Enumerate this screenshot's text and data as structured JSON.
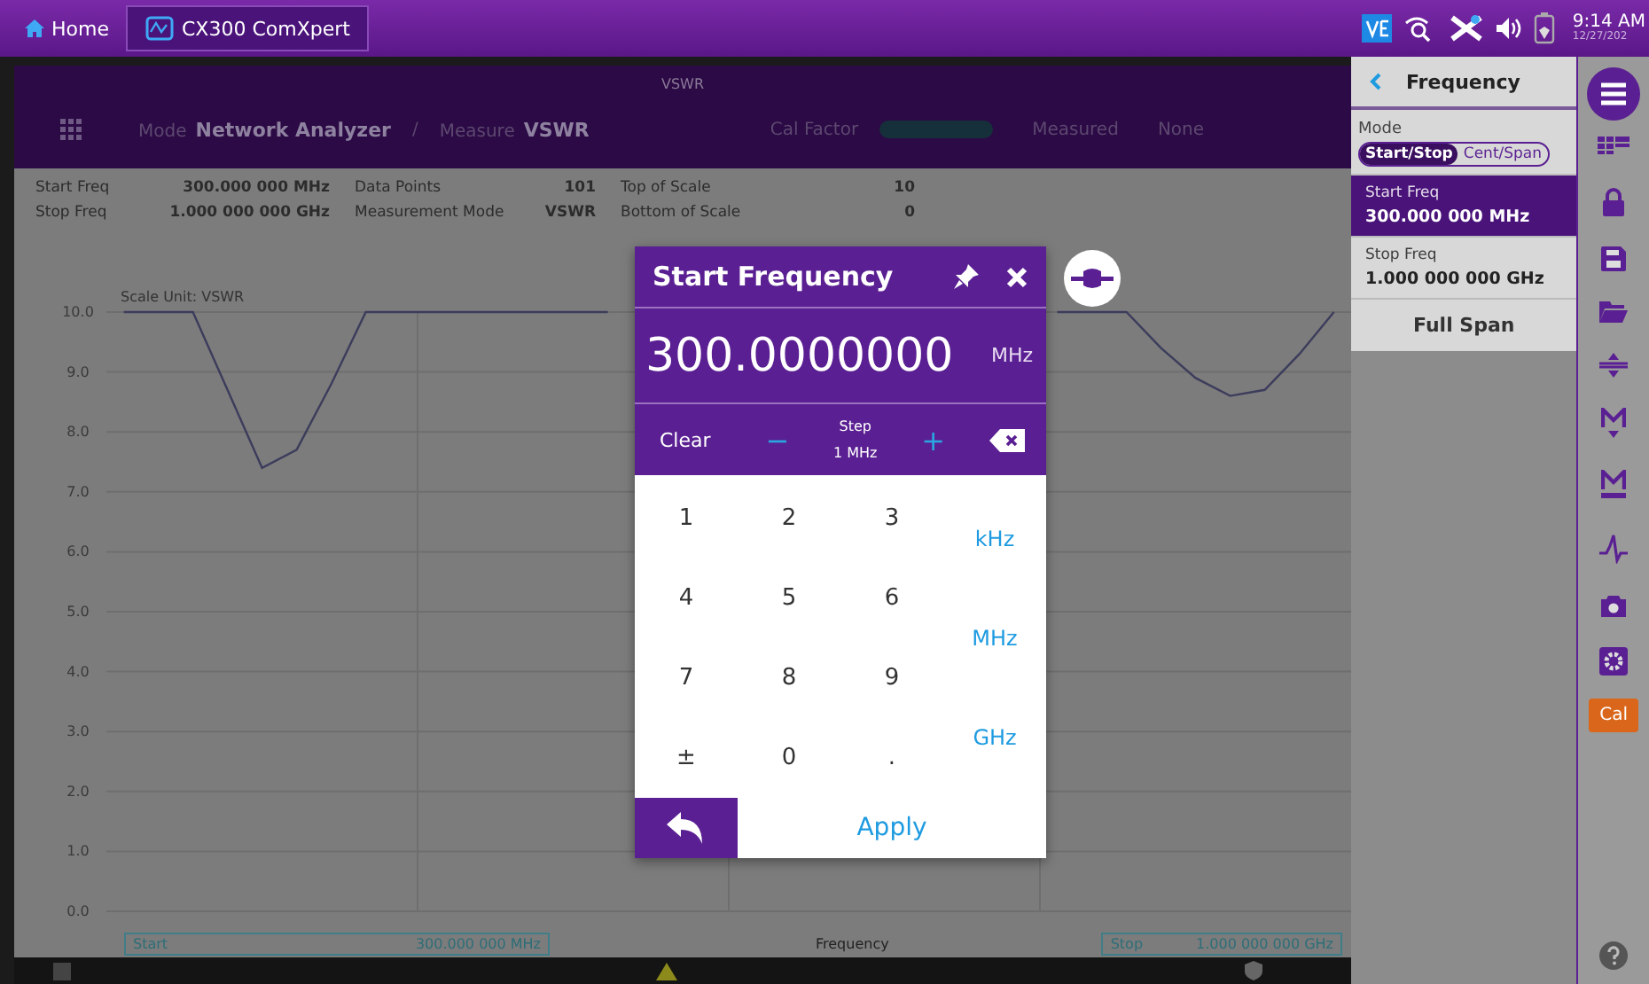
{
  "top_bar": {
    "tabs": [
      {
        "label": "Home",
        "selected": false
      },
      {
        "label": "CX300 ComXpert",
        "selected": true
      }
    ],
    "clock": {
      "time": "9:14 AM",
      "date": "12/27/202"
    }
  },
  "header": {
    "title": "VSWR",
    "mode_label": "Mode",
    "mode": "Network Analyzer",
    "separator": "/",
    "measure_label": "Measure",
    "measure": "VSWR",
    "cal_factor_label": "Cal Factor",
    "cal_factor_items": [
      "Measured",
      "None"
    ]
  },
  "info": [
    {
      "label": "Start Freq",
      "value": "300.000 000 MHz"
    },
    {
      "label": "Stop Freq",
      "value": "1.000 000 000 GHz"
    },
    {
      "label": "Data Points",
      "value": "101"
    },
    {
      "label": "Measurement Mode",
      "value": "VSWR"
    },
    {
      "label": "Top of Scale",
      "value": "10"
    },
    {
      "label": "Bottom of Scale",
      "value": "0"
    }
  ],
  "chart_data": {
    "type": "line",
    "ylabel": "Scale Unit: VSWR",
    "xlabel": "Frequency",
    "ylim": [
      0,
      10
    ],
    "grid": true,
    "yticks": [
      {
        "value": 0,
        "label": "0.0"
      },
      {
        "value": 1,
        "label": "1.0"
      },
      {
        "value": 2,
        "label": "2.0"
      },
      {
        "value": 3,
        "label": "3.0"
      },
      {
        "value": 4,
        "label": "4.0"
      },
      {
        "value": 5,
        "label": "5.0"
      },
      {
        "value": 6,
        "label": "6.0"
      },
      {
        "value": 7,
        "label": "7.0"
      },
      {
        "value": 8,
        "label": "8.0"
      },
      {
        "value": 9,
        "label": "9.0"
      },
      {
        "value": 10,
        "label": "10.0"
      }
    ],
    "categories": [
      null,
      null,
      null,
      null,
      null,
      null,
      null,
      null,
      null,
      null,
      null,
      null,
      null,
      null,
      null,
      null,
      null,
      null,
      null,
      null,
      null,
      null,
      null,
      null,
      null,
      null,
      null,
      null,
      null,
      null,
      null,
      null,
      null,
      null,
      null,
      null
    ],
    "series": [
      {
        "color": "#3c3c5c",
        "values": [
          10,
          10,
          10,
          8.7,
          7.4,
          7.7,
          8.8,
          10,
          10,
          10,
          10,
          10,
          10,
          10,
          10,
          null,
          null,
          null,
          null,
          null,
          null,
          null,
          null,
          null,
          null,
          null,
          null,
          10,
          10,
          10,
          9.4,
          8.9,
          8.6,
          8.7,
          9.3,
          10
        ]
      }
    ]
  },
  "x_axis": {
    "start_label": "Start",
    "start_value": "300.000 000 MHz",
    "stop_label": "Stop",
    "stop_value": "1.000 000 000 GHz"
  },
  "dialog": {
    "title": "Start Frequency",
    "value": "300.0000000",
    "unit": "MHz",
    "clear": "Clear",
    "minus": "−",
    "plus": "+",
    "step_label": "Step",
    "step_value": "1 MHz",
    "keys": [
      "1",
      "2",
      "3",
      "4",
      "5",
      "6",
      "7",
      "8",
      "9",
      "±",
      "0",
      "."
    ],
    "units": [
      "kHz",
      "MHz",
      "GHz"
    ],
    "apply": "Apply"
  },
  "panel": {
    "title": "Frequency",
    "mode_label": "Mode",
    "modes": [
      {
        "label": "Start/Stop",
        "selected": true
      },
      {
        "label": "Cent/Span",
        "selected": false
      }
    ],
    "items": [
      {
        "label": "Start Freq",
        "value": "300.000 000 MHz",
        "selected": true
      },
      {
        "label": "Stop Freq",
        "value": "1.000 000 000 GHz",
        "selected": false
      }
    ],
    "full_span": "Full Span"
  },
  "toolbar": {
    "cal": "Cal"
  }
}
